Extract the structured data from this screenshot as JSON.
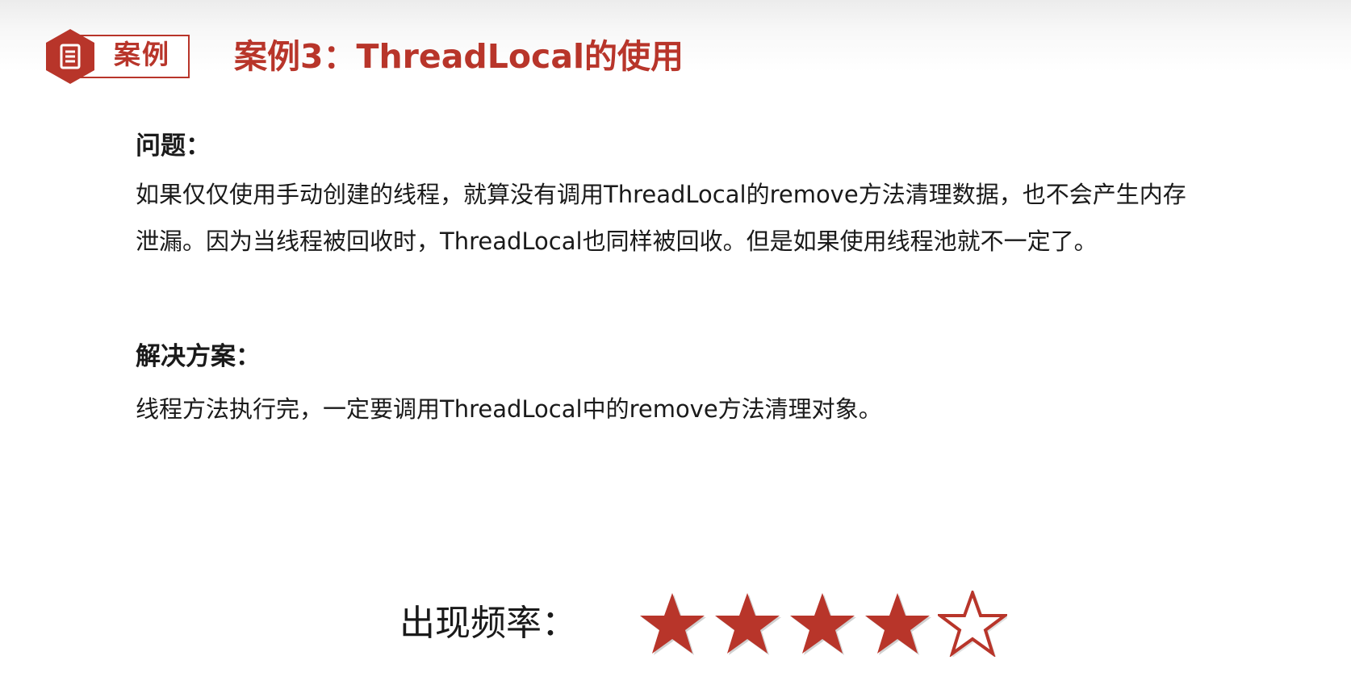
{
  "header": {
    "badge_label": "案例",
    "badge_icon": "document-icon",
    "title": "案例3：ThreadLocal的使用"
  },
  "problem": {
    "heading": "问题：",
    "text": "如果仅仅使用手动创建的线程，就算没有调用ThreadLocal的remove方法清理数据，也不会产生内存泄漏。因为当线程被回收时，ThreadLocal也同样被回收。但是如果使用线程池就不一定了。"
  },
  "solution": {
    "heading": "解决方案：",
    "text": "线程方法执行完，一定要调用ThreadLocal中的remove方法清理对象。"
  },
  "frequency": {
    "label": "出现频率：",
    "rating": 4,
    "max_rating": 5,
    "star_icon": "star-icon"
  },
  "colors": {
    "accent": "#b8352a",
    "text": "#1a1a1a",
    "background": "#ffffff"
  }
}
